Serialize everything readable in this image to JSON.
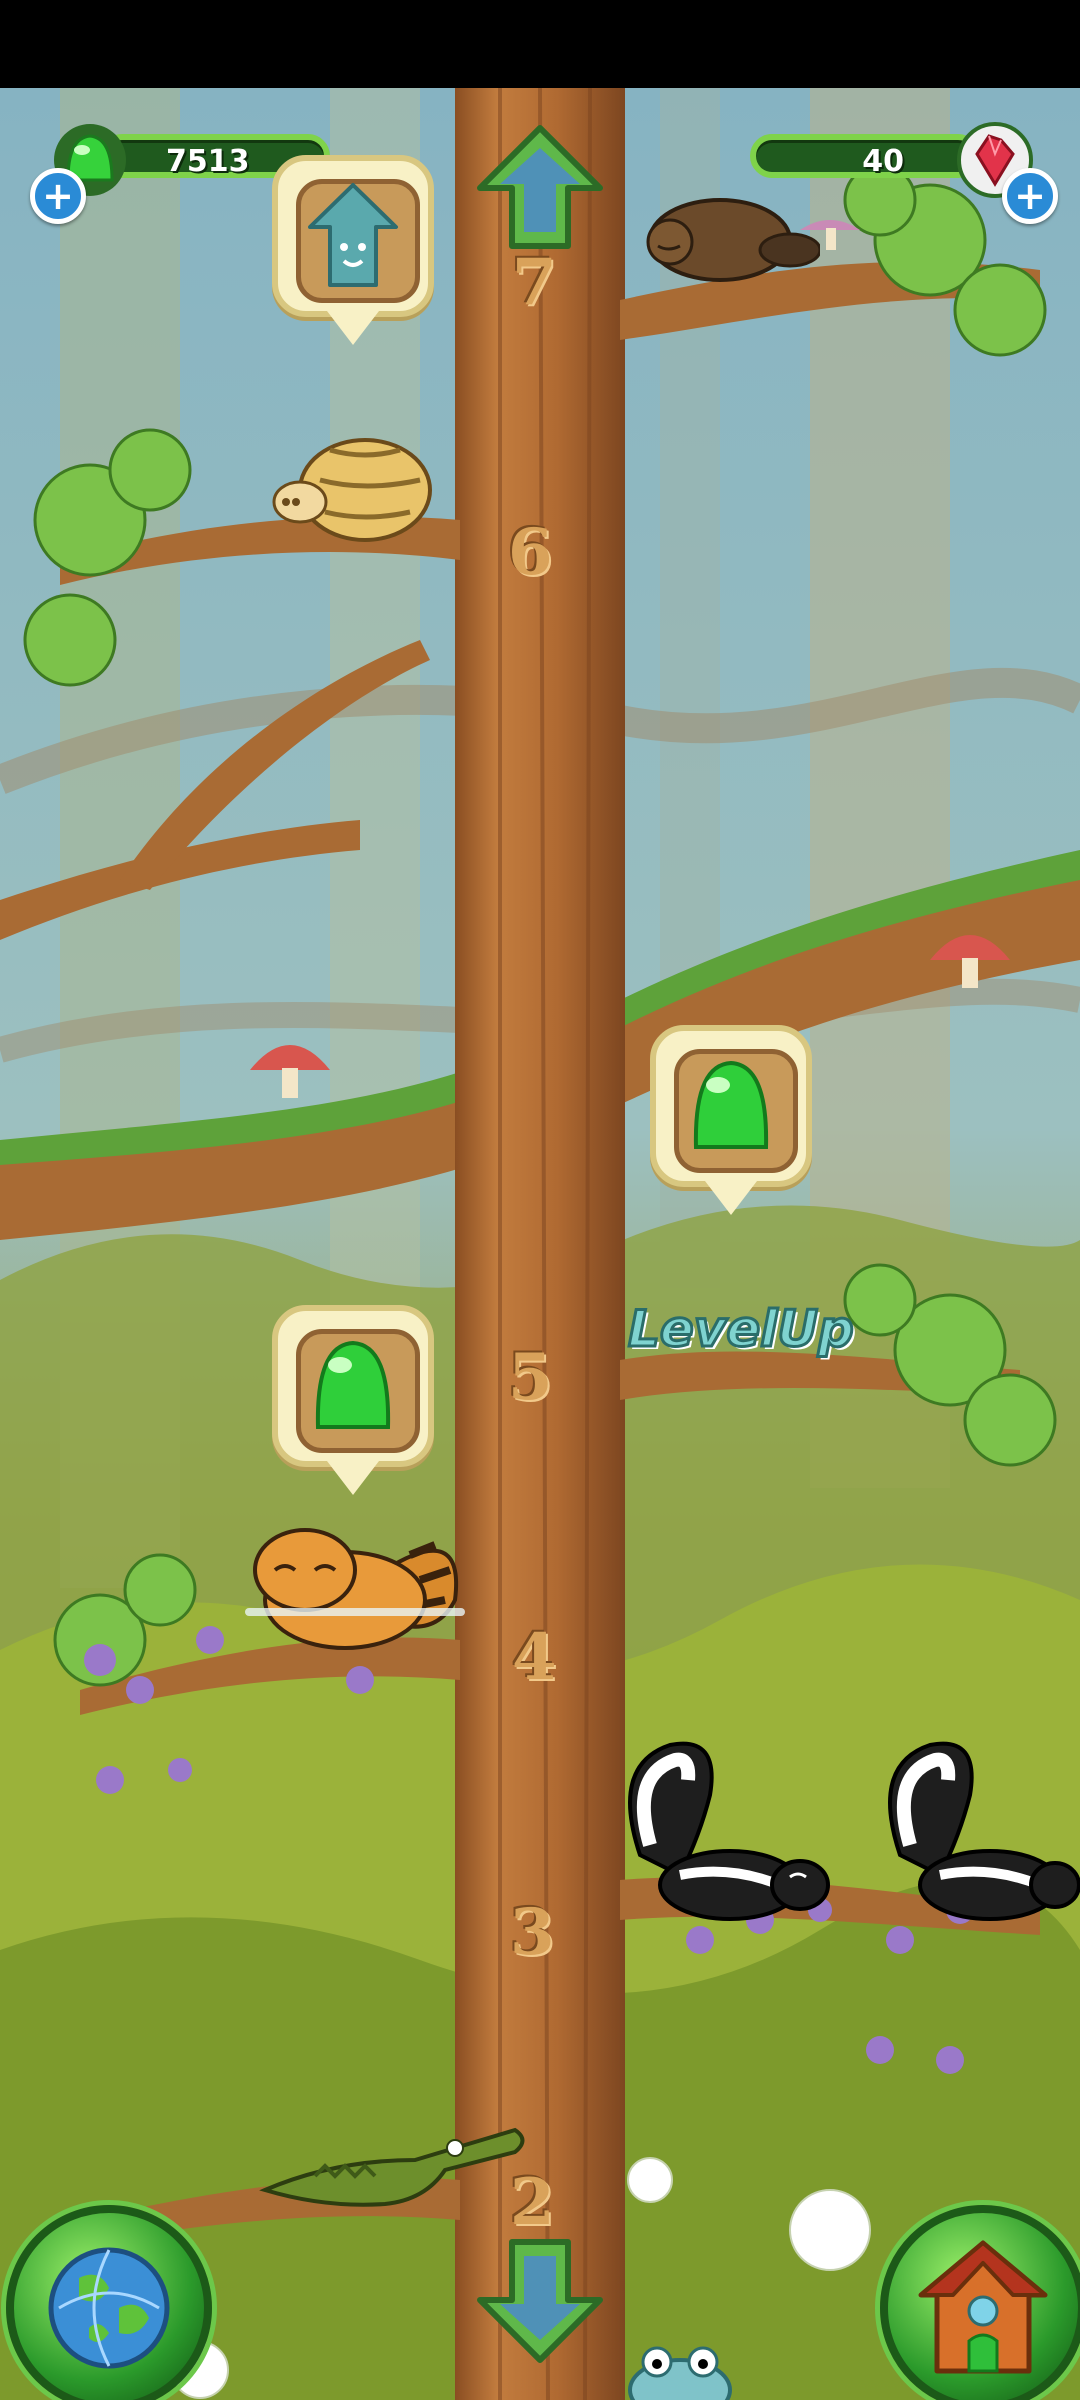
{
  "hud": {
    "jelly_count": "7513",
    "gem_count": "40",
    "add_icon": "plus-icon"
  },
  "tree": {
    "floor_labels": [
      "7",
      "6",
      "5",
      "4",
      "3",
      "2"
    ],
    "level_up_label": "LevelUp"
  },
  "buttons": {
    "up_icon": "arrow-up-icon",
    "down_icon": "arrow-down-icon",
    "world_icon": "globe-icon",
    "home_icon": "house-icon"
  },
  "colors": {
    "tree_trunk": "#b9733a",
    "sky": "#8fb7c4",
    "jelly_green": "#2fcf3a",
    "hud_bar": "#1f5a1e"
  }
}
